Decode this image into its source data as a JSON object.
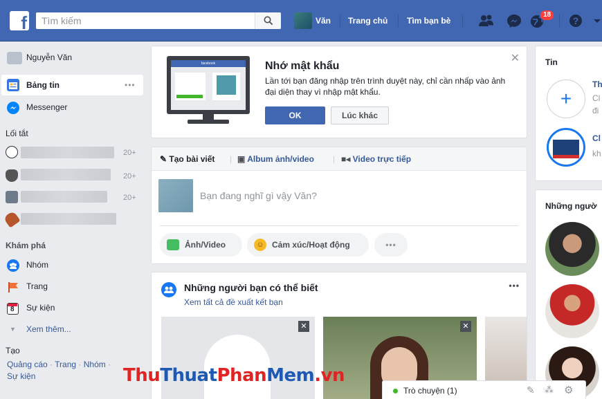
{
  "topbar": {
    "search_placeholder": "Tìm kiếm",
    "user_short": "Văn",
    "home": "Trang chủ",
    "find_friends": "Tìm bạn bè",
    "notification_count": "18"
  },
  "sidebar": {
    "user_name": "Nguyễn Văn",
    "news_feed": "Bảng tin",
    "messenger": "Messenger",
    "shortcuts_heading": "Lối tắt",
    "shortcut_counts": [
      "20+",
      "20+",
      "20+"
    ],
    "explore_heading": "Khám phá",
    "explore": [
      "Nhóm",
      "Trang",
      "Sự kiện"
    ],
    "see_more": "Xem thêm...",
    "create_heading": "Tạo",
    "create_links": [
      "Quảng cáo",
      "Trang",
      "Nhóm",
      "Sự kiện"
    ],
    "calendar_day": "8"
  },
  "password_prompt": {
    "title": "Nhớ mật khẩu",
    "body": "Lần tới bạn đăng nhập trên trình duyệt này, chỉ cần nhấp vào ảnh đại diện thay vì nhập mật khẩu.",
    "ok": "OK",
    "later": "Lúc khác",
    "illustration_label": "facebook"
  },
  "composer": {
    "tabs": [
      "Tạo bài viết",
      "Album ảnh/video",
      "Video trực tiếp"
    ],
    "placeholder": "Bạn đang nghĩ gì vậy Văn?",
    "actions": [
      "Ảnh/Video",
      "Cảm xúc/Hoạt động"
    ]
  },
  "pymk": {
    "title": "Những người bạn có thể biết",
    "see_all": "Xem tất cả đề xuất kết bạn"
  },
  "right": {
    "stories_title": "Tin",
    "story_1_initial": "Th",
    "story_1_sub": "Cl",
    "story_1_sub2": "đi",
    "story_2_initial": "Cl",
    "story_2_sub": "kh",
    "people_title": "Những ngườ"
  },
  "chat": {
    "label": "Trò chuyện (1)"
  },
  "watermark": {
    "part1": "Thu",
    "part2": "Thuat",
    "part3": "Phan",
    "part4": "Mem",
    "part5": ".vn"
  },
  "colors": {
    "brand": "#4267b2",
    "link": "#365899",
    "bg": "#e9ebee",
    "badge": "#fa3e3e"
  }
}
